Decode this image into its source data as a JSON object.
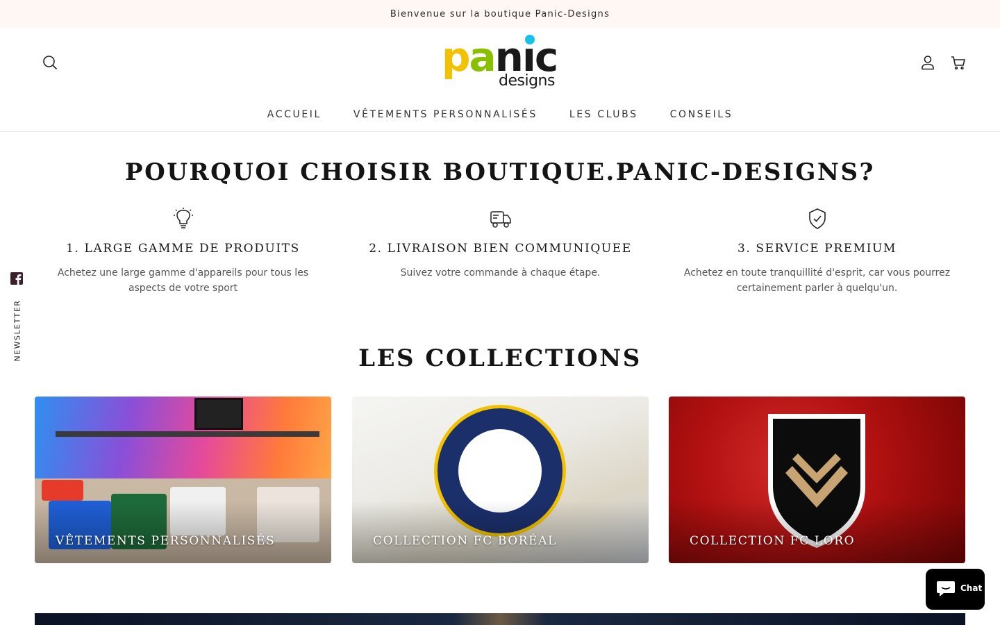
{
  "announcement": "Bienvenue sur la boutique Panic-Designs",
  "logo": {
    "word_p": "p",
    "word_a": "a",
    "word_n": "n",
    "word_i": "ı",
    "word_c": "c",
    "sub": "designs",
    "colors": {
      "p": "#f2c200",
      "a": "#88c000",
      "dot": "#19c0e8"
    }
  },
  "icons": {
    "search": "search-icon",
    "account": "user-icon",
    "cart": "cart-icon"
  },
  "nav": {
    "items": [
      {
        "label": "ACCUEIL"
      },
      {
        "label": "VÊTEMENTS PERSONNALISÉS"
      },
      {
        "label": "LES CLUBS"
      },
      {
        "label": "CONSEILS"
      }
    ]
  },
  "why": {
    "title": "POURQUOI CHOISIR BOUTIQUE.PANIC-DESIGNS?",
    "features": [
      {
        "icon": "lightbulb-icon",
        "title": "1. LARGE GAMME DE PRODUITS",
        "text": "Achetez une large gamme d'appareils pour tous les aspects de votre sport"
      },
      {
        "icon": "delivery-truck-icon",
        "title": "2. LIVRAISON BIEN COMMUNIQUEE",
        "text": "Suivez votre commande à chaque étape."
      },
      {
        "icon": "shield-check-icon",
        "title": "3. SERVICE PREMIUM",
        "text": "Achetez en toute tranquillité d'esprit, car vous pourrez certainement parler à quelqu'un."
      }
    ]
  },
  "collections": {
    "title": "LES COLLECTIONS",
    "cards": [
      {
        "label": "VÊTEMENTS PERSONNALISÉS"
      },
      {
        "label": "COLLECTION FC BORÉAL"
      },
      {
        "label": "COLLECTION FC LORO"
      }
    ]
  },
  "sidebar": {
    "facebook": "facebook-icon",
    "newsletter": "NEWSLETTER"
  },
  "chat": {
    "label": "Chat"
  }
}
